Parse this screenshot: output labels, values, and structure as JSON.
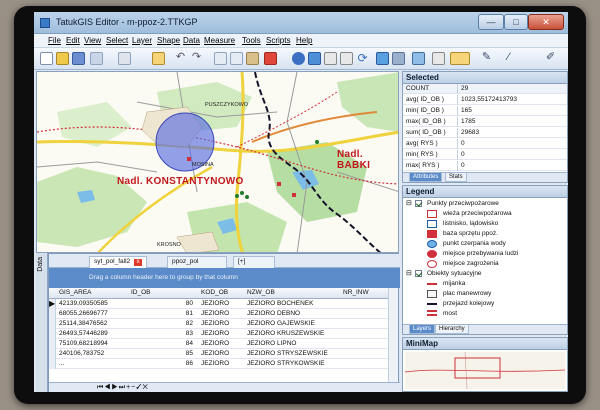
{
  "window": {
    "title": "TatukGIS Editor - m-ppoz-2.TTKGP",
    "min_label": "—",
    "max_label": "□",
    "close_label": "✕"
  },
  "menu": [
    "File",
    "Edit",
    "View",
    "Select",
    "Layer",
    "Shape",
    "Data",
    "Measure",
    "Tools",
    "Scripts",
    "Help"
  ],
  "map": {
    "labels": {
      "konstantynowo": "Nadl. KONSTANTYNOWO",
      "babki": "Nadl. BABKI",
      "puszczykowo": "PUSZCZYKOWO",
      "mosina": "MOSINA",
      "krosno": "KROSNO"
    },
    "colors": {
      "district": "#c2181d",
      "river": "#14142a",
      "forest": "#9fd08c",
      "water": "#6fb3e6",
      "selection": "#5a6ee0"
    }
  },
  "data_panel": {
    "side_tab": "Data",
    "tabs": [
      "syt_pol_fall2",
      "ppoz_pol",
      "[+]"
    ],
    "group_hint": "Drag a column header here to group by that column",
    "columns": [
      "GIS_AREA",
      "ID_OB",
      "KOD_OB",
      "NZW_OB",
      "NR_INW"
    ],
    "rows": [
      {
        "area": "42139,09350585",
        "id": "80",
        "kod": "JEZIORO",
        "nzw": "JEZIORO BOCHENEK"
      },
      {
        "area": "68055,26696777",
        "id": "81",
        "kod": "JEZIORO",
        "nzw": "JEZIORO DEBNO"
      },
      {
        "area": "25114,38476562",
        "id": "82",
        "kod": "JEZIORO",
        "nzw": "JEZIORO GAJEWSKIE"
      },
      {
        "area": "26493,57446289",
        "id": "83",
        "kod": "JEZIORO",
        "nzw": "JEZIORO KRUSZEWSKIE"
      },
      {
        "area": "75109,68218994",
        "id": "84",
        "kod": "JEZIORO",
        "nzw": "JEZIORO LIPNO"
      },
      {
        "area": "240106,783752",
        "id": "85",
        "kod": "JEZIORO",
        "nzw": "JEZIORO STRYSZEWSKIE"
      },
      {
        "area": "...",
        "id": "86",
        "kod": "JEZIORO",
        "nzw": "JEZIORO STRYKOWSKIE"
      }
    ]
  },
  "selected": {
    "title": "Selected",
    "rows": [
      {
        "key": "COUNT",
        "value": "29"
      },
      {
        "key": "avg( ID_OB )",
        "value": "1023,55172413793"
      },
      {
        "key": "min( ID_OB )",
        "value": "165"
      },
      {
        "key": "max( ID_OB )",
        "value": "1785"
      },
      {
        "key": "sum( ID_OB )",
        "value": "29683"
      },
      {
        "key": "avg( RYS )",
        "value": "0"
      },
      {
        "key": "min( RYS )",
        "value": "0"
      },
      {
        "key": "max( RYS )",
        "value": "0"
      }
    ],
    "tabs": [
      "Attributes",
      "Stats"
    ]
  },
  "legend": {
    "title": "Legend",
    "items": [
      {
        "label": "Punkty przeciwpożarowe",
        "level": 0,
        "group": true
      },
      {
        "label": "wieża przeciwpożarowa",
        "level": 1,
        "sym": "tower"
      },
      {
        "label": "listnisko, lądowisko",
        "level": 1,
        "sym": "heli"
      },
      {
        "label": "baza sprzętu ppoż.",
        "level": 1,
        "sym": "base"
      },
      {
        "label": "punkt czerpania wody",
        "level": 1,
        "sym": "water"
      },
      {
        "label": "miejsce przebywania ludzi",
        "level": 1,
        "sym": "people"
      },
      {
        "label": "miejsce zagrożenia",
        "level": 1,
        "sym": "danger"
      },
      {
        "label": "Obiekty sytuacyjne",
        "level": 0,
        "group": true
      },
      {
        "label": "mijanka",
        "level": 1,
        "sym": "line-red"
      },
      {
        "label": "plac manewrowy",
        "level": 1,
        "sym": "square"
      },
      {
        "label": "przejazd kolejowy",
        "level": 1,
        "sym": "rail"
      },
      {
        "label": "most",
        "level": 1,
        "sym": "bridge"
      }
    ],
    "tabs": [
      "Layers",
      "Hierarchy"
    ]
  },
  "minimap": {
    "title": "MiniMap"
  }
}
